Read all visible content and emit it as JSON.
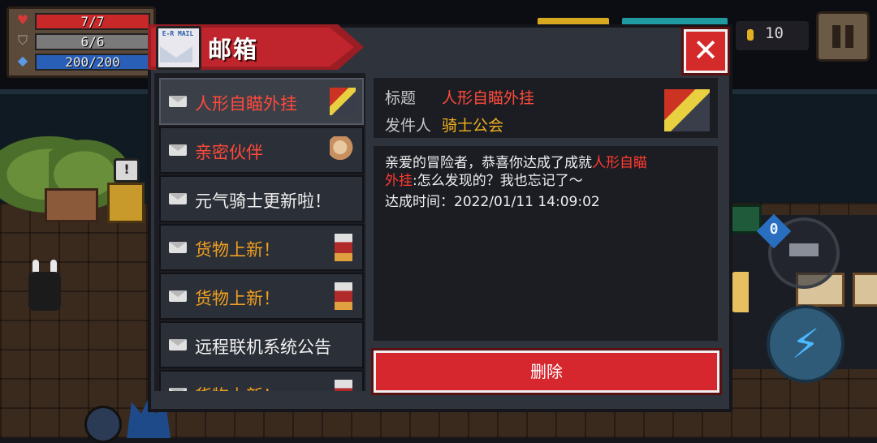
{
  "hud": {
    "hp": {
      "text": "7/7",
      "color": "#c82828",
      "fraction": 1.0,
      "icon": "heart-icon"
    },
    "armor": {
      "text": "6/6",
      "color": "#7a7a7a",
      "fraction": 1.0,
      "icon": "shield-icon"
    },
    "energy": {
      "text": "200/200",
      "color": "#2a5fb8",
      "fraction": 1.0,
      "icon": "diamond-icon"
    },
    "coins": "10",
    "weapon_badge": "0"
  },
  "mailbox": {
    "title": "邮箱",
    "logo_text": "E-R MAIL",
    "close_icon": "close-icon",
    "items": [
      {
        "label": "人形自瞄外挂",
        "color": "#ff4a3a",
        "thumb": "robot",
        "active": true
      },
      {
        "label": "亲密伙伴",
        "color": "#ff4a3a",
        "thumb": "pair",
        "active": false
      },
      {
        "label": "元气骑士更新啦！",
        "color": "#f0f0f0",
        "thumb": "none",
        "active": false
      },
      {
        "label": "货物上新！",
        "color": "#f0a020",
        "thumb": "merchant",
        "active": false
      },
      {
        "label": "货物上新！",
        "color": "#f0a020",
        "thumb": "merchant",
        "active": false
      },
      {
        "label": "远程联机系统公告",
        "color": "#f0f0f0",
        "thumb": "none",
        "active": false
      },
      {
        "label": "货物上新！",
        "color": "#f0a020",
        "thumb": "merchant",
        "active": false
      }
    ],
    "detail": {
      "subject_label": "标题",
      "subject_value": "人形自瞄外挂",
      "sender_label": "发件人",
      "sender_value": "骑士公会",
      "body_prefix": "亲爱的冒险者，恭喜你达成了成就",
      "body_highlight_1": "人形自瞄",
      "body_highlight_2": "外挂",
      "body_suffix": ":怎么发现的？我也忘记了～",
      "achieved_time": "达成时间：2022/01/11 14:09:02"
    },
    "delete_label": "删除"
  }
}
